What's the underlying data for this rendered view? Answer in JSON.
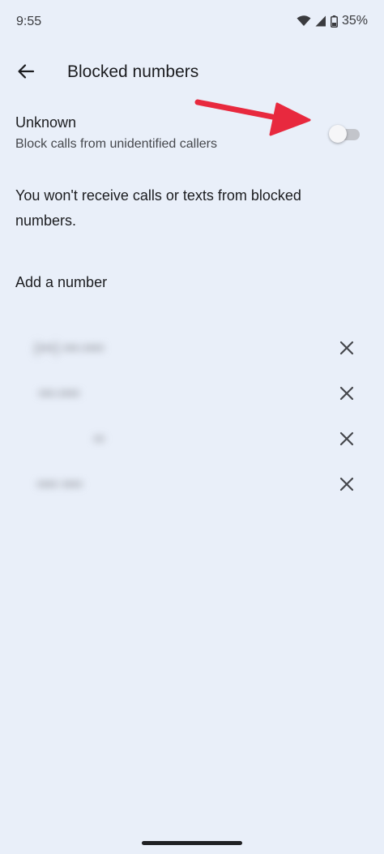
{
  "status_bar": {
    "time": "9:55",
    "battery": "35%",
    "icons": [
      "wifi-icon",
      "signal-icon",
      "battery-icon"
    ]
  },
  "app_bar": {
    "back_icon": "arrow-back-icon",
    "title": "Blocked numbers"
  },
  "unknown_setting": {
    "title": "Unknown",
    "subtitle": "Block calls from unidentified callers",
    "enabled": false
  },
  "info_text": "You won't receive calls or texts from blocked numbers.",
  "add_number_label": "Add a number",
  "blocked_numbers": [
    {
      "display": "(•••) •••-••••",
      "remove_icon": "close-icon"
    },
    {
      "display": "•••-••••",
      "remove_icon": "close-icon"
    },
    {
      "display": "••",
      "remove_icon": "close-icon"
    },
    {
      "display": "•••• ••••",
      "remove_icon": "close-icon"
    }
  ],
  "colors": {
    "background": "#e9eff9",
    "annotation_arrow": "#e8293e",
    "toggle_track_off": "#c3c5cb"
  }
}
